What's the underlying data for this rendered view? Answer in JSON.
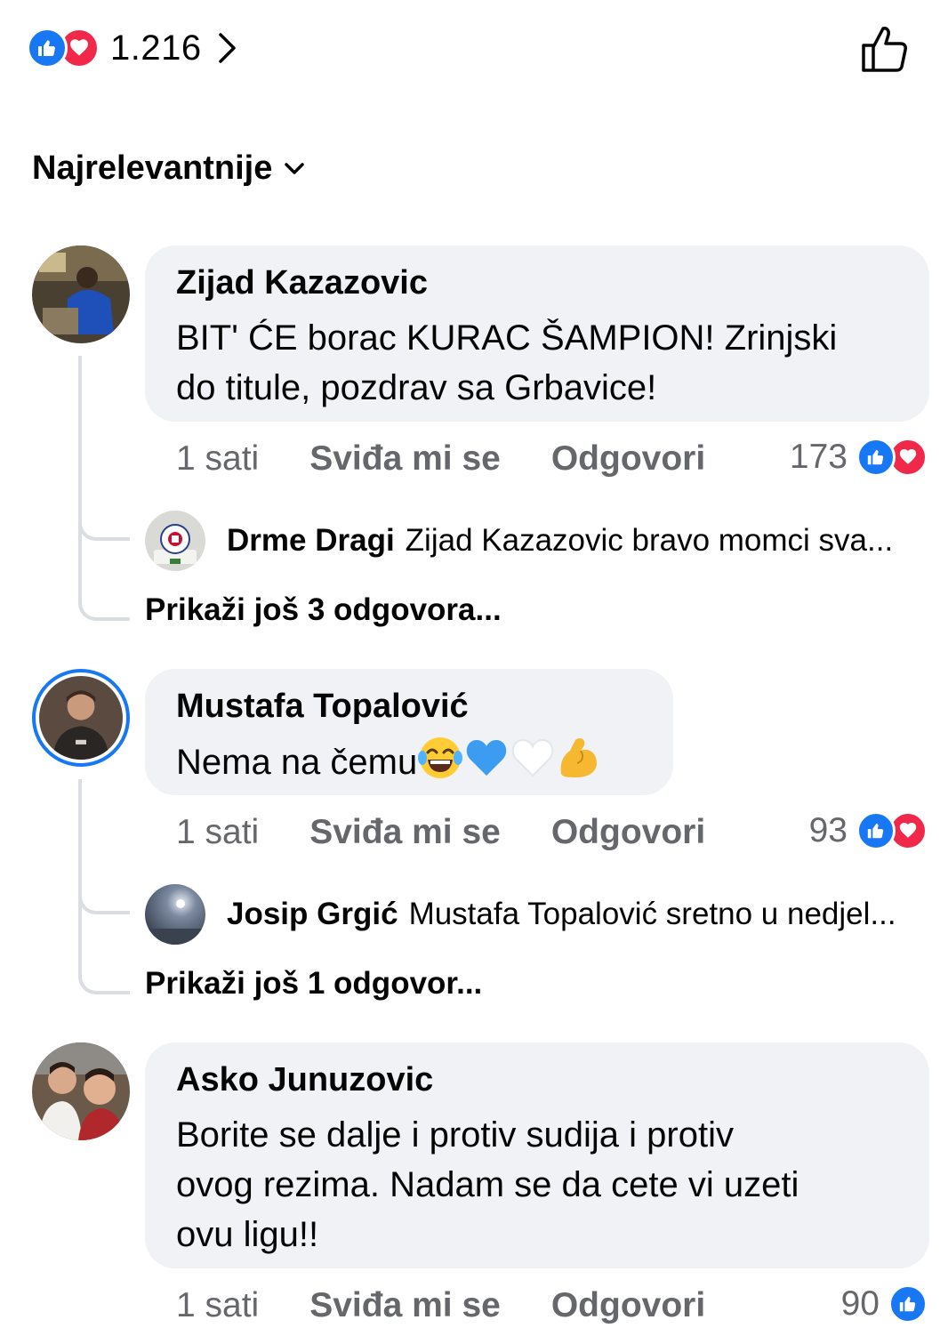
{
  "header": {
    "reaction_total": "1.216",
    "reaction_icons": [
      "like-icon",
      "love-icon"
    ]
  },
  "sort": {
    "label": "Najrelevantnije"
  },
  "comments": [
    {
      "author": "Zijad Kazazovic",
      "text_lines": [
        "BIT' ĆE borac KURAC ŠAMPION! Zrinjski",
        "do titule, pozdrav sa Grbavice!"
      ],
      "time": "1 sati",
      "like_label": "Sviđa mi se",
      "reply_label": "Odgovori",
      "reaction_count": "173",
      "reply_preview": {
        "author": "Drme Dragi",
        "text": "Zijad Kazazovic bravo momci sva..."
      },
      "more_replies": "Prikaži još 3 odgovora..."
    },
    {
      "author": "Mustafa Topalović",
      "text": "Nema na čemu",
      "emojis": [
        "tears-of-joy-emoji",
        "blue-heart-emoji",
        "white-heart-emoji",
        "flexed-biceps-emoji"
      ],
      "time": "1 sati",
      "like_label": "Sviđa mi se",
      "reply_label": "Odgovori",
      "reaction_count": "93",
      "reply_preview": {
        "author": "Josip Grgić",
        "text": "Mustafa Topalović sretno u nedjel..."
      },
      "more_replies": "Prikaži još 1 odgovor..."
    },
    {
      "author": "Asko Junuzovic",
      "text_lines": [
        "Borite se dalje i protiv sudija i protiv",
        "ovog rezima. Nadam se da cete vi uzeti",
        "ovu ligu!!"
      ],
      "time": "1 sati",
      "like_label": "Sviđa mi se",
      "reply_label": "Odgovori",
      "reaction_count": "90"
    }
  ],
  "colors": {
    "like_blue": "#1877f2",
    "love_red": "#f02849",
    "bubble_bg": "#f0f2f5",
    "meta_gray": "#65676b"
  }
}
